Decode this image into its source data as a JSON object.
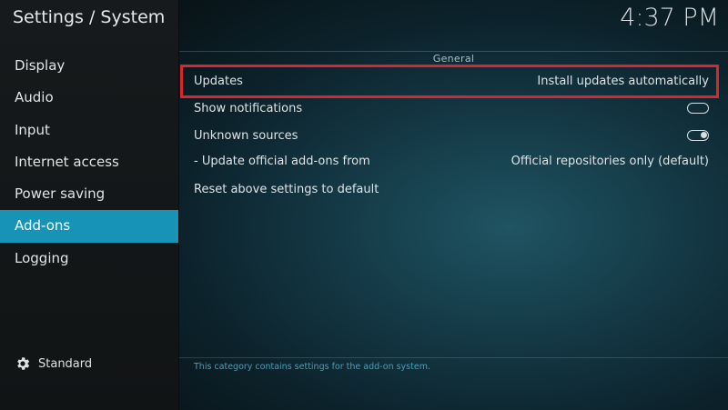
{
  "header": {
    "title": "Settings / System",
    "clock": "4:37 PM"
  },
  "sidebar": {
    "items": [
      {
        "label": "Display"
      },
      {
        "label": "Audio"
      },
      {
        "label": "Input"
      },
      {
        "label": "Internet access"
      },
      {
        "label": "Power saving"
      },
      {
        "label": "Add-ons",
        "active": true
      },
      {
        "label": "Logging"
      }
    ],
    "level_icon": "gear-icon",
    "level_label": "Standard"
  },
  "main": {
    "section_title": "General",
    "rows": [
      {
        "label": "Updates",
        "value": "Install updates automatically"
      },
      {
        "label": "Show notifications",
        "toggle": "off"
      },
      {
        "label": "Unknown sources",
        "toggle": "on"
      },
      {
        "label": "- Update official add-ons from",
        "value": "Official repositories only (default)"
      },
      {
        "label": "Reset above settings to default"
      }
    ],
    "footer": "This category contains settings for the add-on system."
  },
  "colors": {
    "accent": "#1793b6",
    "highlight_outline": "#d72630",
    "footer_text": "#3fa2bf"
  }
}
